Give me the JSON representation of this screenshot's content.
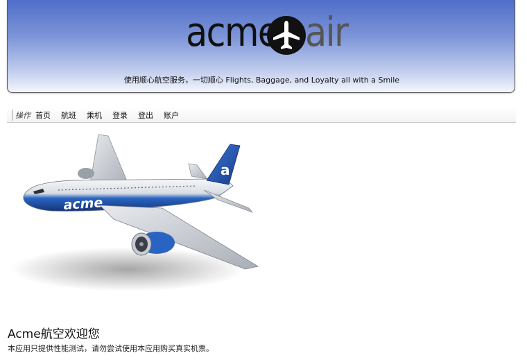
{
  "header": {
    "logo": {
      "word_left": "acme",
      "word_right": "air",
      "badge_icon": "airplane-icon"
    },
    "tagline": "使用顺心航空服务，一切顺心 Flights, Baggage, and Loyalty all with a Smile"
  },
  "nav": {
    "label": "操作",
    "items": [
      {
        "label": "首页"
      },
      {
        "label": "航班"
      },
      {
        "label": "乘机"
      },
      {
        "label": "登录"
      },
      {
        "label": "登出"
      },
      {
        "label": "账户"
      }
    ]
  },
  "hero": {
    "image_icon": "airliner-illustration",
    "fuselage_text": "acme",
    "tail_text": "a"
  },
  "welcome": {
    "title": "Acme航空欢迎您",
    "text": "本应用只提供性能测试，请勿尝试使用本应用购买真实机票。"
  },
  "colors": {
    "banner_top": "#4f6ec9",
    "banner_bottom": "#f4f6fc",
    "brand_blue": "#1f4fa8"
  }
}
